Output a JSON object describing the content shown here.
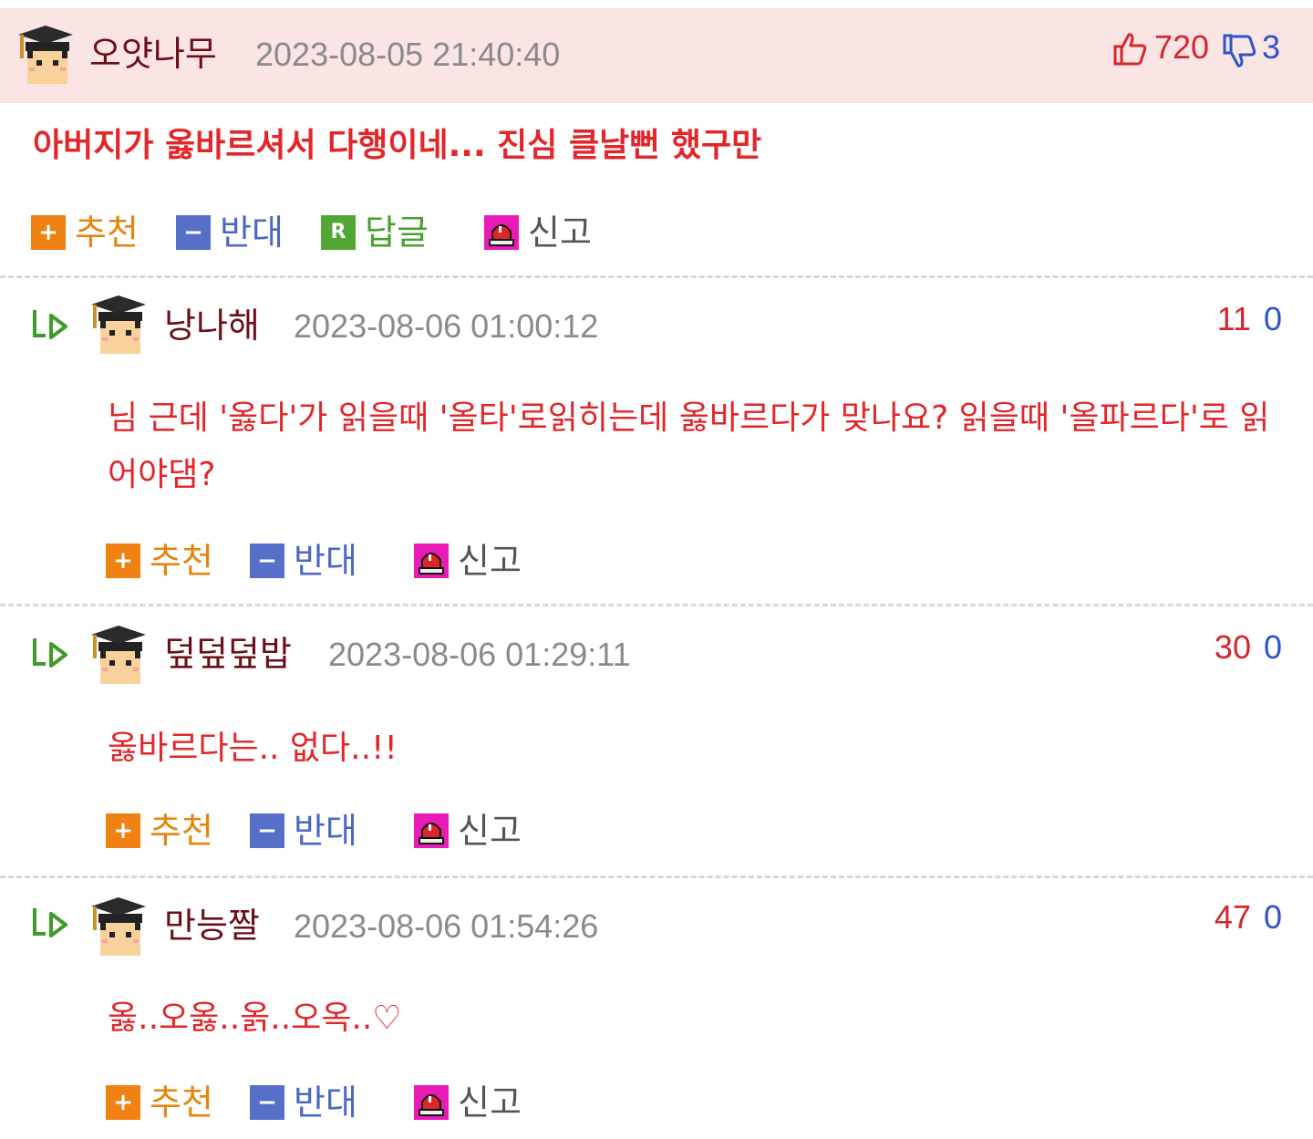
{
  "main_comment": {
    "nickname": "오얏나무",
    "date": "2023-08-05 21:40:40",
    "upvotes": "720",
    "downvotes": "3",
    "text": "아버지가 옳바르셔서 다행이네... 진심 클날뻔 했구만",
    "actions": {
      "recommend": "추천",
      "oppose": "반대",
      "reply": "답글",
      "report": "신고"
    }
  },
  "replies": [
    {
      "nickname": "낭나해",
      "date": "2023-08-06 01:00:12",
      "upvotes": "11",
      "downvotes": "0",
      "text": "님 근데 '옳다'가 읽을때 '올타'로읽히는데 옳바르다가 맞나요? 읽을때 '올파르다'로 읽어야댐?",
      "actions": {
        "recommend": "추천",
        "oppose": "반대",
        "report": "신고"
      }
    },
    {
      "nickname": "덮덮덮밥",
      "date": "2023-08-06 01:29:11",
      "upvotes": "30",
      "downvotes": "0",
      "text": "옳바르다는.. 없다..!!",
      "actions": {
        "recommend": "추천",
        "oppose": "반대",
        "report": "신고"
      }
    },
    {
      "nickname": "만능짤",
      "date": "2023-08-06 01:54:26",
      "upvotes": "47",
      "downvotes": "0",
      "text": "옳..오옳..옭..오옥..♡",
      "actions": {
        "recommend": "추천",
        "oppose": "반대",
        "report": "신고"
      }
    }
  ],
  "colors": {
    "accent_red": "#e2262a",
    "header_bg": "#fbe4e4",
    "nickname": "#6a0f17",
    "recommend": "#ef8212",
    "oppose": "#5670c8",
    "reply": "#52a734",
    "report": "#ea1ab8"
  },
  "icons": {
    "avatar": "graduate-avatar-icon",
    "up": "thumbs-up-icon",
    "down": "thumbs-down-icon",
    "reply_arrow": "reply-arrow-icon",
    "report": "siren-icon"
  }
}
